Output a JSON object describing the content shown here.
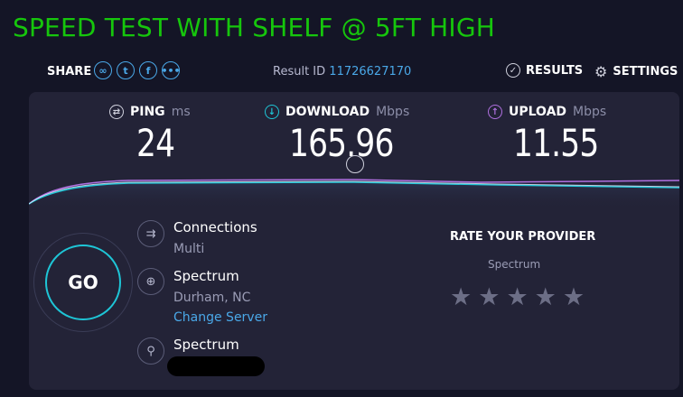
{
  "page_title": "SPEED TEST WITH SHELF @ 5FT HIGH",
  "toolbar": {
    "share_label": "SHARE",
    "share_icons": [
      "link-icon",
      "twitter-icon",
      "facebook-icon",
      "more-icon"
    ],
    "result_label": "Result ID",
    "result_id": "11726627170",
    "results_label": "RESULTS",
    "settings_label": "SETTINGS"
  },
  "metrics": {
    "ping": {
      "label": "PING",
      "unit": "ms",
      "value": "24"
    },
    "download": {
      "label": "DOWNLOAD",
      "unit": "Mbps",
      "value": "165.96"
    },
    "upload": {
      "label": "UPLOAD",
      "unit": "Mbps",
      "value": "11.55"
    }
  },
  "go_label": "GO",
  "connections": {
    "title": "Connections",
    "value": "Multi"
  },
  "server": {
    "title": "Spectrum",
    "location": "Durham, NC",
    "change_label": "Change Server"
  },
  "provider": {
    "title": "Spectrum"
  },
  "rate": {
    "title": "RATE YOUR PROVIDER",
    "provider": "Spectrum",
    "stars": 5
  },
  "colors": {
    "title_green": "#16c60c",
    "accent_blue": "#4aa8e8",
    "download_cyan": "#1ec5d6",
    "upload_purple": "#b070e0",
    "panel_bg": "#232337",
    "page_bg": "#141526"
  }
}
